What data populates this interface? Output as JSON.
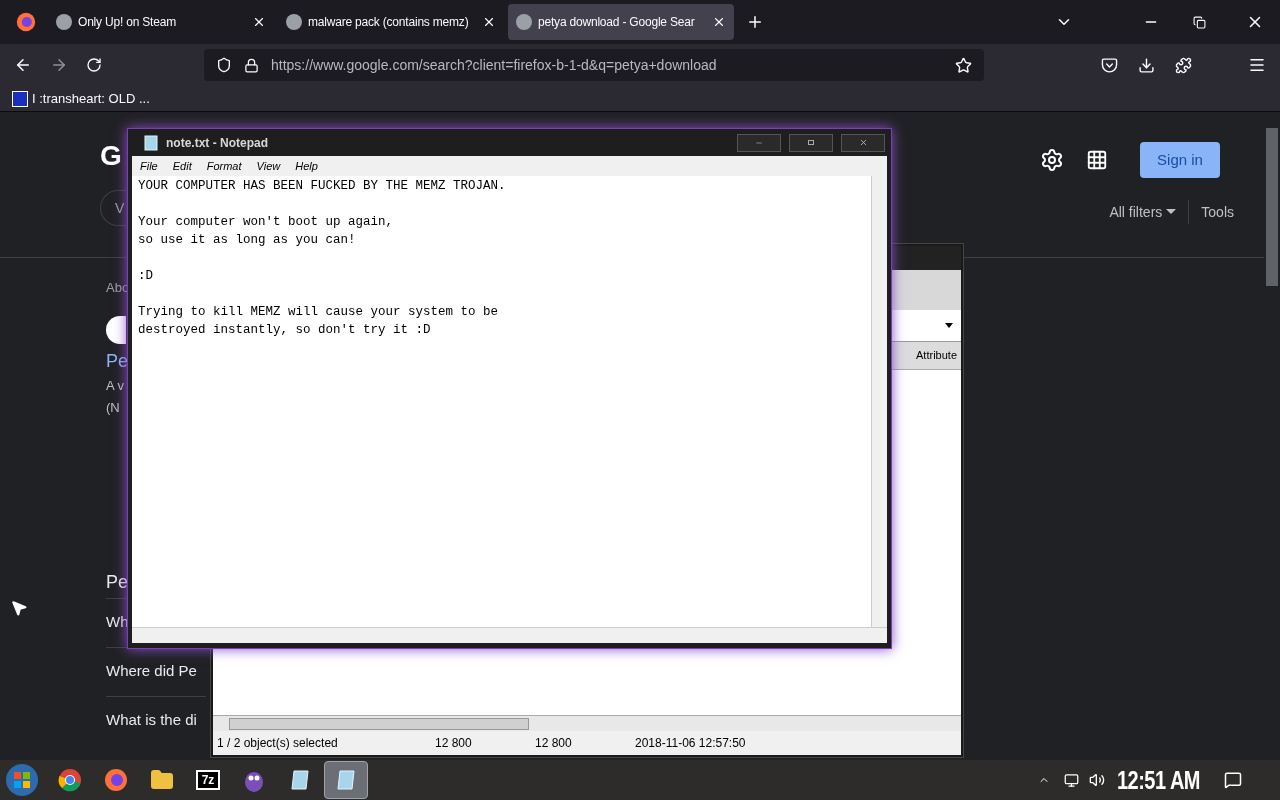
{
  "browser": {
    "tabs": [
      {
        "title": "Only Up! on Steam",
        "selected": false
      },
      {
        "title": "malware pack (contains memz)",
        "selected": false
      },
      {
        "title": "petya download - Google Sear",
        "selected": true
      }
    ],
    "url": "https://www.google.com/search?client=firefox-b-1-d&q=petya+download",
    "bookmarks": [
      {
        "label": "I :transheart: OLD ..."
      }
    ]
  },
  "google": {
    "logo": "G",
    "chip": "V",
    "sign_in": "Sign in",
    "all_filters": "All filters",
    "tools": "Tools",
    "result_stats": "Abo",
    "result_title": "Pe",
    "result_snippet": [
      "A v",
      "(N"
    ],
    "section_heading": "Pe",
    "questions": [
      "Wh",
      "Where did Pe",
      "What is the di"
    ]
  },
  "archive_window": {
    "column_header": "Attribute",
    "status": [
      "1 / 2 object(s) selected",
      "12 800",
      "12 800",
      "2018-11-06 12:57:50"
    ]
  },
  "notepad": {
    "title": "note.txt - Notepad",
    "menu": [
      "File",
      "Edit",
      "Format",
      "View",
      "Help"
    ],
    "paragraphs": [
      {
        "lines": [
          "YOUR COMPUTER HAS BEEN FUCKED BY THE MEMZ TROJAN."
        ]
      },
      {
        "lines": [
          "Your computer won't boot up again,",
          "so use it as long as you can!"
        ]
      },
      {
        "lines": [
          ":D"
        ]
      },
      {
        "lines": [
          "Trying to kill MEMZ will cause your system to be",
          "destroyed instantly, so don't try it :D"
        ]
      }
    ]
  },
  "taskbar": {
    "items": [
      {
        "kind": "chrome",
        "selected": false
      },
      {
        "kind": "firefox",
        "selected": false
      },
      {
        "kind": "folder",
        "selected": false
      },
      {
        "kind": "archiver",
        "label": "7z",
        "selected": false
      },
      {
        "kind": "creature",
        "selected": false
      },
      {
        "kind": "notepad",
        "selected": false
      },
      {
        "kind": "notepad",
        "selected": true
      }
    ],
    "clock": "12:51 AM"
  }
}
